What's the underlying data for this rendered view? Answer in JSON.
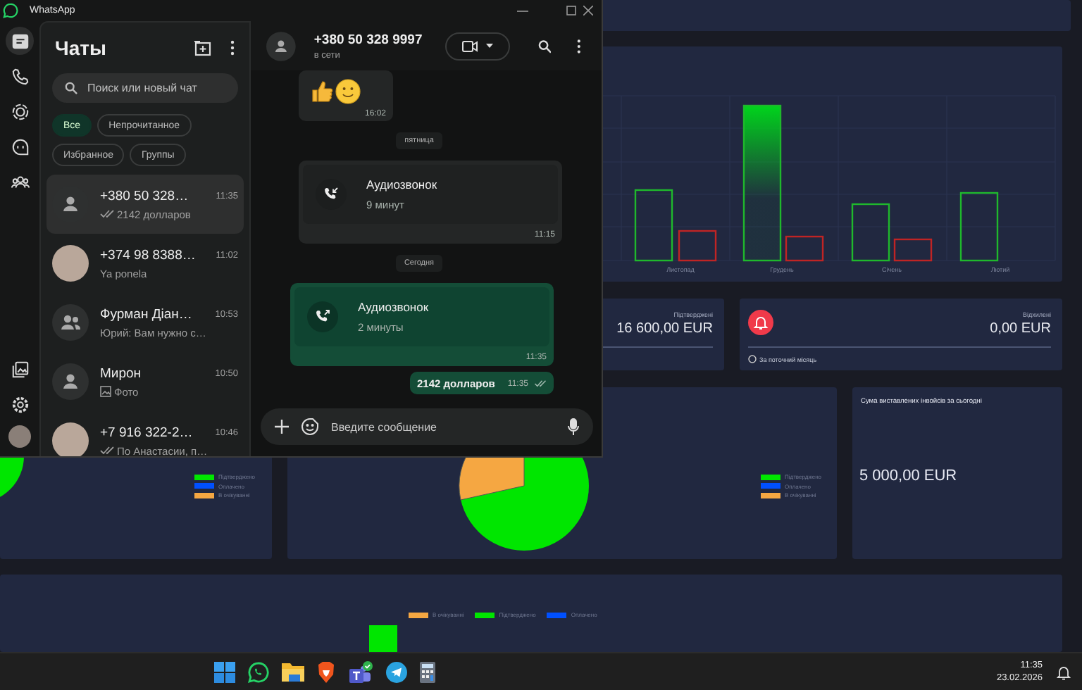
{
  "window": {
    "title": "WhatsApp"
  },
  "rail": {
    "top": [
      {
        "kind": "chats",
        "selected": true
      },
      {
        "kind": "calls",
        "selected": false
      },
      {
        "kind": "status",
        "selected": false
      },
      {
        "kind": "channels",
        "selected": false
      },
      {
        "kind": "communities",
        "selected": false
      }
    ],
    "bottom": [
      {
        "kind": "media"
      },
      {
        "kind": "settings"
      },
      {
        "kind": "profile"
      }
    ]
  },
  "chat_list": {
    "title": "Чаты",
    "search": {
      "placeholder": "Поиск или новый чат"
    },
    "filters": [
      {
        "label": "Все",
        "selected": true
      },
      {
        "label": "Непрочитанное",
        "selected": false
      },
      {
        "label": "Избранное",
        "selected": false
      },
      {
        "label": "Группы",
        "selected": false
      }
    ],
    "chats": [
      {
        "name": "+380 50 328…",
        "time": "11:35",
        "preview": "2142 долларов",
        "avatar": {
          "kind": "person"
        },
        "ticks": true,
        "photo_attachment": false,
        "selected": true
      },
      {
        "name": "+374 98 8388…",
        "time": "11:02",
        "preview": "Ya ponela",
        "avatar": {
          "kind": "photo"
        },
        "ticks": false,
        "photo_attachment": false,
        "selected": false
      },
      {
        "name": "Фурман Діан…",
        "time": "10:53",
        "preview": "Юрий: Вам нужно с…",
        "avatar": {
          "kind": "group"
        },
        "ticks": false,
        "photo_attachment": false,
        "selected": false
      },
      {
        "name": "Мирон",
        "time": "10:50",
        "preview": "Фото",
        "avatar": {
          "kind": "person"
        },
        "ticks": false,
        "photo_attachment": true,
        "selected": false
      },
      {
        "name": "+7 916 322-2…",
        "time": "10:46",
        "preview": "По Анастасии, п…",
        "avatar": {
          "kind": "photo"
        },
        "ticks": true,
        "photo_attachment": false,
        "selected": false
      }
    ]
  },
  "chat": {
    "name": "+380 50 328 9997",
    "status": "в сети",
    "messages": [
      {
        "kind": "emoji",
        "time": "16:02",
        "outgoing": false
      },
      {
        "kind": "date",
        "text": "пятница"
      },
      {
        "kind": "call",
        "title": "Аудиозвонок",
        "duration": "9 минут",
        "time": "11:15",
        "outgoing": false
      },
      {
        "kind": "date",
        "text": "Сегодня"
      },
      {
        "kind": "call",
        "title": "Аудиозвонок",
        "duration": "2 минуты",
        "time": "11:35",
        "outgoing": true
      },
      {
        "kind": "text",
        "text": "2142 долларов",
        "time": "11:35",
        "outgoing": true,
        "ticks": true
      }
    ],
    "composer": {
      "placeholder": "Введите сообщение"
    }
  },
  "dashboard": {
    "months": [
      "Листопад",
      "Грудень",
      "Січень",
      "Лютий"
    ],
    "stats": [
      {
        "label": "Підтверджені",
        "value": "16 600,00 EUR"
      },
      {
        "label": "Відхилені",
        "value": "0,00 EUR",
        "note": "За поточний місяць"
      }
    ],
    "status_legend_left": [
      {
        "label": "Підтверджено",
        "color": "#00e600"
      },
      {
        "label": "Оплачено",
        "color": "#0050ff"
      },
      {
        "label": "В очікуванні",
        "color": "#f5a742"
      }
    ],
    "status_legend_middle": [
      {
        "label": "Підтверджено",
        "color": "#00e600"
      },
      {
        "label": "Оплачено",
        "color": "#0050ff"
      },
      {
        "label": "В очікуванні",
        "color": "#f5a742"
      }
    ],
    "today": {
      "title": "Сума виставлених інвойсів за сьогодні",
      "value": "5 000,00 EUR"
    },
    "bottom_legend": [
      {
        "label": "В очікуванні",
        "color": "#f5a742"
      },
      {
        "label": "Підтверджено",
        "color": "#00e600"
      },
      {
        "label": "Оплачено",
        "color": "#0050ff"
      }
    ]
  },
  "taskbar": {
    "time": "11:35",
    "date": "23.02.2026"
  }
}
